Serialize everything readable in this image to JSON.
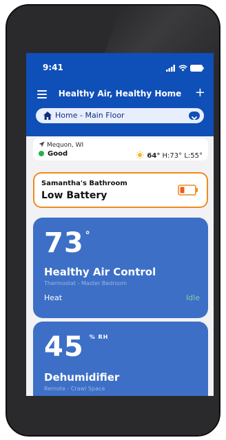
{
  "status_bar": {
    "time": "9:41"
  },
  "header": {
    "title": "Healthy Air, Healthy Home"
  },
  "location": {
    "selected": "Home - Main Floor"
  },
  "weather": {
    "city": "Mequon, WI",
    "air_quality": "Good",
    "temp": "64°",
    "hilo": "H:73° L:55°"
  },
  "alert": {
    "room": "Samantha's Bathroom",
    "status": "Low Battery"
  },
  "devices": [
    {
      "value": "73",
      "unit": "°",
      "name": "Healthy Air Control",
      "subtitle": "Thermostat - Master Bedroom",
      "mode": "Heat",
      "state": "Idle"
    },
    {
      "value": "45",
      "unit": "% RH",
      "name": "Dehumidifier",
      "subtitle": "Remote - Crawl Space"
    }
  ],
  "colors": {
    "header_blue": "#0f4fb8",
    "card_blue": "#3d6fc6",
    "alert_orange": "#f08a1c",
    "good_green": "#22b14c"
  },
  "icons": [
    "signal-icon",
    "wifi-icon",
    "battery-icon",
    "menu-icon",
    "plus-icon",
    "home-icon",
    "chevron-down-icon",
    "location-arrow-icon",
    "sun-icon",
    "low-battery-icon"
  ]
}
